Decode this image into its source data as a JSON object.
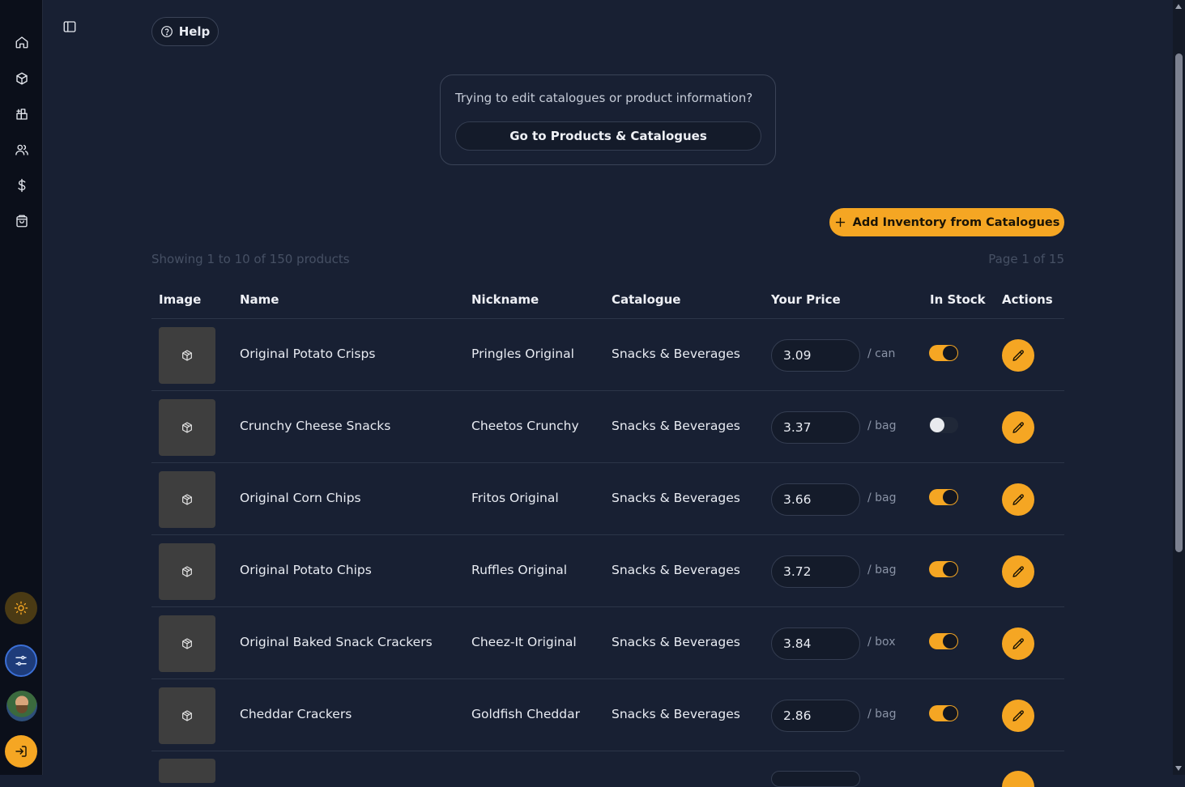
{
  "help": {
    "label": "Help"
  },
  "notice": {
    "text": "Trying to edit catalogues or product information?",
    "button_label": "Go to Products & Catalogues"
  },
  "add_button": {
    "label": "Add Inventory from Catalogues"
  },
  "pagination": {
    "showing": "Showing 1 to 10 of 150 products",
    "page": "Page 1 of 15"
  },
  "table": {
    "columns": [
      "Image",
      "Name",
      "Nickname",
      "Catalogue",
      "Your Price",
      "In Stock",
      "Actions"
    ],
    "rows": [
      {
        "name": "Original Potato Crisps",
        "nickname": "Pringles Original",
        "catalogue": "Snacks & Beverages",
        "price": "3.09",
        "unit": "/ can",
        "in_stock": true
      },
      {
        "name": "Crunchy Cheese Snacks",
        "nickname": "Cheetos Crunchy",
        "catalogue": "Snacks & Beverages",
        "price": "3.37",
        "unit": "/ bag",
        "in_stock": false
      },
      {
        "name": "Original Corn Chips",
        "nickname": "Fritos Original",
        "catalogue": "Snacks & Beverages",
        "price": "3.66",
        "unit": "/ bag",
        "in_stock": true
      },
      {
        "name": "Original Potato Chips",
        "nickname": "Ruffles Original",
        "catalogue": "Snacks & Beverages",
        "price": "3.72",
        "unit": "/ bag",
        "in_stock": true
      },
      {
        "name": "Original Baked Snack Crackers",
        "nickname": "Cheez-It Original",
        "catalogue": "Snacks & Beverages",
        "price": "3.84",
        "unit": "/ box",
        "in_stock": true
      },
      {
        "name": "Cheddar Crackers",
        "nickname": "Goldfish Cheddar",
        "catalogue": "Snacks & Beverages",
        "price": "2.86",
        "unit": "/ bag",
        "in_stock": true
      }
    ]
  },
  "sidebar": {
    "icons": [
      "home-icon",
      "box-icon",
      "grid-plus-icon",
      "users-icon",
      "dollar-icon",
      "bag-icon"
    ]
  },
  "colors": {
    "accent": "#f5a623",
    "background": "#182033",
    "sidebar": "#0b0f1a"
  }
}
